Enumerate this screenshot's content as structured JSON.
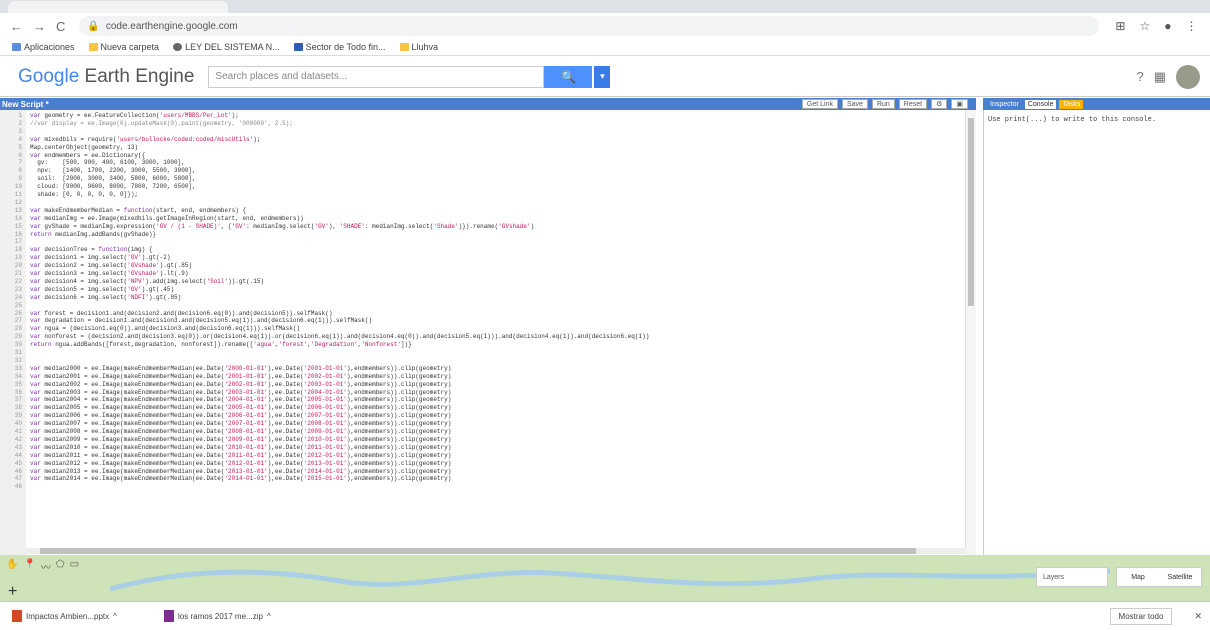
{
  "browser": {
    "url": "code.earthengine.google.com",
    "bookmarks": [
      {
        "label": "Aplicaciones"
      },
      {
        "label": "Nueva carpeta"
      },
      {
        "label": "LEY DEL SISTEMA N..."
      },
      {
        "label": "Sector de Todo fin..."
      },
      {
        "label": "Lluhva"
      }
    ]
  },
  "gee": {
    "logo_google": "Google",
    "logo_rest": " Earth Engine",
    "search_placeholder": "Search places and datasets...",
    "editor_title": "New Script *",
    "toolbar": {
      "get_link": "Get Link",
      "save": "Save",
      "run": "Run",
      "reset": "Reset"
    },
    "right_tabs": {
      "inspector": "Inspector",
      "console": "Console",
      "tasks": "Tasks"
    },
    "console_message": "Use print(...) to write to this console."
  },
  "code": {
    "lines": [
      "var geometry = ee.FeatureCollection('users/MBBS/Per_Lot');",
      "//var display = ee.Image(0).updateMask(0).paint(geometry, '000000', 2.5);",
      "",
      "var mixedbils = require('users/bullocke/coded:coded/miscUtils');",
      "Map.centerObject(geometry, 13)",
      "var endmembers = ee.Dictionary({",
      "  gv:    [500, 900, 400, 6100, 3000, 1000],",
      "  npv:   [1400, 1700, 2200, 3000, 5500, 3000],",
      "  soil:  [2000, 3000, 3400, 5800, 6000, 5800],",
      "  cloud: [9000, 9600, 8000, 7800, 7200, 6500],",
      "  shade: [0, 0, 0, 0, 0, 0]});",
      "",
      "var makeEndmemberMedian = function(start, end, endmembers) {",
      "var medianImg = ee.Image(mixedbils.getImageInRegion(start, end, endmembers))",
      "var gvShade = medianImg.expression('GV / (1 - SHADE)', {'GV': medianImg.select('GV'), 'SHADE': medianImg.select('Shade')}).rename('GVshade')",
      "return medianImg.addBands(gvShade)}",
      "",
      "var decisionTree = function(img) {",
      "var decision1 = img.select('GV').gt(-2)",
      "var decision2 = img.select('GVshade').gt(.85)",
      "var decision3 = img.select('GVshade').lt(.9)",
      "var decision4 = img.select('NPV').add(img.select('Soil')).gt(.15)",
      "var decision5 = img.select('GV').gt(.45)",
      "var decision6 = img.select('NDFI').gt(.85)",
      "",
      "var forest = decision1.and(decision2.and(decision6.eq(0)).and(decision5)).selfMask()",
      "var degradation = decision1.and(decision3.and(decision5.eq(1)).and(decision6.eq(1))).selfMask()",
      "var ngua = (decision1.eq(0)).and(decision3.and(decision6.eq(1))).selfMask()",
      "var nonforest = (decision2.and(decision3.eq(0)).or(decision4.eq(1)).or(decision6.eq(1)).and(decision4.eq(0)).and(decision5.eq(1))).and(decision4.eq(1)).and(decision6.eq(1))",
      "return ngua.addBands([forest,degradation, nonforest]).rename(['agua','forest','Degradation','Nonforest'])}",
      "",
      "",
      "var median2000 = ee.Image(makeEndmemberMedian(ee.Date('2000-01-01'),ee.Date('2001-01-01'),endmembers)).clip(geometry)",
      "var median2001 = ee.Image(makeEndmemberMedian(ee.Date('2001-01-01'),ee.Date('2002-01-01'),endmembers)).clip(geometry)",
      "var median2002 = ee.Image(makeEndmemberMedian(ee.Date('2002-01-01'),ee.Date('2003-01-01'),endmembers)).clip(geometry)",
      "var median2003 = ee.Image(makeEndmemberMedian(ee.Date('2003-01-01'),ee.Date('2004-01-01'),endmembers)).clip(geometry)",
      "var median2004 = ee.Image(makeEndmemberMedian(ee.Date('2004-01-01'),ee.Date('2005-01-01'),endmembers)).clip(geometry)",
      "var median2005 = ee.Image(makeEndmemberMedian(ee.Date('2005-01-01'),ee.Date('2006-01-01'),endmembers)).clip(geometry)",
      "var median2006 = ee.Image(makeEndmemberMedian(ee.Date('2006-01-01'),ee.Date('2007-01-01'),endmembers)).clip(geometry)",
      "var median2007 = ee.Image(makeEndmemberMedian(ee.Date('2007-01-01'),ee.Date('2008-01-01'),endmembers)).clip(geometry)",
      "var median2008 = ee.Image(makeEndmemberMedian(ee.Date('2008-01-01'),ee.Date('2009-01-01'),endmembers)).clip(geometry)",
      "var median2009 = ee.Image(makeEndmemberMedian(ee.Date('2009-01-01'),ee.Date('2010-01-01'),endmembers)).clip(geometry)",
      "var median2010 = ee.Image(makeEndmemberMedian(ee.Date('2010-01-01'),ee.Date('2011-01-01'),endmembers)).clip(geometry)",
      "var median2011 = ee.Image(makeEndmemberMedian(ee.Date('2011-01-01'),ee.Date('2012-01-01'),endmembers)).clip(geometry)",
      "var median2012 = ee.Image(makeEndmemberMedian(ee.Date('2012-01-01'),ee.Date('2013-01-01'),endmembers)).clip(geometry)",
      "var median2013 = ee.Image(makeEndmemberMedian(ee.Date('2013-01-01'),ee.Date('2014-01-01'),endmembers)).clip(geometry)",
      "var median2014 = ee.Image(makeEndmemberMedian(ee.Date('2014-01-01'),ee.Date('2015-01-01'),endmembers)).clip(geometry)",
      ""
    ]
  },
  "map": {
    "layers_label": "Layers",
    "map_label": "Map",
    "satellite_label": "Satellite"
  },
  "downloads": {
    "items": [
      {
        "label": "Impactos Ambien...pptx"
      },
      {
        "label": "los ramos 2017 me...zip"
      }
    ],
    "show_all": "Mostrar todo"
  }
}
